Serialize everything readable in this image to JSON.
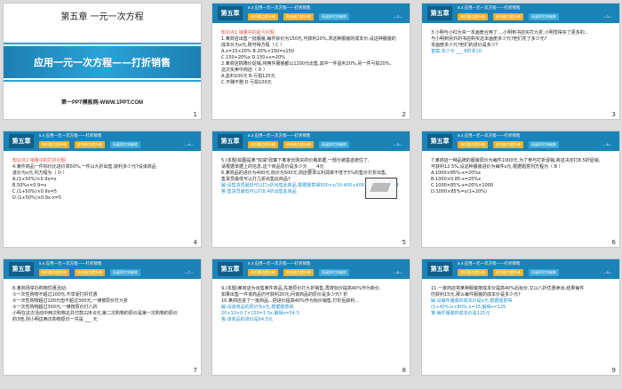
{
  "cover": {
    "chapter": "第五章 一元一次方程",
    "subtitle": "应用一元一次方程——打折销售",
    "website": "第一PPT模板网-WWW.1PPT.COM",
    "page": "1"
  },
  "header": {
    "chapter_label": "第五章",
    "section": "5.4 应用一元一次方程——打折销售",
    "tab1": "知识要点提升练",
    "tab2": "综合能力提升练",
    "tab3": "拓展探究突破练"
  },
  "slides": [
    {
      "page": "2",
      "lines": [
        {
          "t": "知识点1 销量中的盈亏问题",
          "c": "hl"
        },
        {
          "t": "1.某商店出售一批服装,每件标价为150元,可获利20%,求这种服装的成本价.设这种服装的",
          "c": ""
        },
        {
          "t": "成本价为x元,则可得方程（ C ）",
          "c": ""
        },
        {
          "t": "A.x=15×20%   B.20%×150=x150",
          "c": ""
        },
        {
          "t": "C.150+20%x D.150+x=20%",
          "c": ""
        },
        {
          "t": "2.某商店搞降价促销,将两件服装都以1200元出售,其中一件盈利20%,另一件亏损20%,",
          "c": ""
        },
        {
          "t": "这次买卖中商店（ D ）",
          "c": ""
        },
        {
          "t": "A.盈利100元  B.亏损125元",
          "c": ""
        },
        {
          "t": "C.不赚不赔  D.亏损100元",
          "c": ""
        }
      ]
    },
    {
      "page": "3",
      "lines": [
        {
          "t": "3.小明与小红为买一本画册合用了...,小明到书店买打九折,小明觉得买了更多的...",
          "c": ""
        },
        {
          "t": "与小明到另外的书店购买这本画册多少元?他们花了多少元?",
          "c": ""
        },
        {
          "t": "本画册多少元?他们的进价是多少?",
          "c": ""
        },
        {
          "t": "答案:多少元 ___ 8折多10",
          "c": "ans"
        }
      ]
    },
    {
      "page": "4",
      "lines": [
        {
          "t": "知识点2 销量中的打折问题",
          "c": "hl"
        },
        {
          "t": "4.某件商品一件标价比进价高50%,一件以九折出售,获利多少元?设该商品",
          "c": ""
        },
        {
          "t": "进价为x元,列方程为（ D ）",
          "c": ""
        },
        {
          "t": "A.(1+50%)×0.9x=x",
          "c": ""
        },
        {
          "t": "B.50%x×0.9=x",
          "c": ""
        },
        {
          "t": "C.(1+50%)×0.9x=5",
          "c": ""
        },
        {
          "t": "D.(1+50%)×0.9x-x=5",
          "c": ""
        }
      ]
    },
    {
      "page": "5",
      "lines": [
        {
          "t": "5.(本题)如图是某\"双减\"政策下某家长购买的价格单据,一部分被墨迹遮住了,",
          "c": ""
        },
        {
          "t": "请根据单据上的信息,这个商品原价是多少元 ___ 4元",
          "c": ""
        },
        {
          "t": "6.某商品的进价为400元,标价为500元,商店要求以利润率不低于5%的售价打折出售,",
          "c": ""
        },
        {
          "t": "售货员最低可以打几折出售此商品?",
          "c": ""
        },
        {
          "t": "解:设售货员最低可以打x折出售此商品,根据题意得500×x/10-400≥400×5%,解得x≥8.4",
          "c": "ans"
        },
        {
          "t": "答:售货员最低可以打8.4折出售此商品",
          "c": "ans"
        }
      ]
    },
    {
      "page": "6",
      "lines": [
        {
          "t": "7.某商店一种品牌的服装原价为每件1000元,为了参与打折促销,商店决定打8.5折促销,",
          "c": ""
        },
        {
          "t": "可获利12.5%,设这种服装进价为每件x元,根据题意列方程为（ B ）",
          "c": ""
        },
        {
          "t": "A.1000×85%-x=20%x",
          "c": ""
        },
        {
          "t": "B.1000×0.85-x=20%x",
          "c": ""
        },
        {
          "t": "C.1000×85%-x=20%×1000",
          "c": ""
        },
        {
          "t": "D.1000×85%=x(1+20%)",
          "c": ""
        }
      ]
    },
    {
      "page": "7",
      "lines": [
        {
          "t": "8.某商场举办购物优惠活动:",
          "c": ""
        },
        {
          "t": "①一次性购物不超过100元,不享受打折优惠",
          "c": ""
        },
        {
          "t": "②一次性购物超过100元但不超过300元,一律按原价打九折",
          "c": ""
        },
        {
          "t": "③一次性购物超过300元,一律按原价打八折",
          "c": ""
        },
        {
          "t": "小明在这次活动中两次购物总共付款228.6元,第二次购物的原价是第一次购物的原价",
          "c": ""
        },
        {
          "t": "的3倍,则小明这两次购物原价一共是 ___ 元",
          "c": ""
        }
      ]
    },
    {
      "page": "8",
      "lines": [
        {
          "t": "9.(本题)某商店为出售某件商品,先按原价打九折销售,再按标价提高40%作为新价,",
          "c": ""
        },
        {
          "t": "如果出售一件该商品仍可获利20元,问该商品的原价是多少元? 折",
          "c": ""
        },
        {
          "t": "10.某商店进了一批商品...把进价提高40%作为标价销售,打折后获利...",
          "c": ""
        },
        {
          "t": "解:设该商品的原价为x元,根据题意得",
          "c": "ans"
        },
        {
          "t": "20+10×0.7×150=1.5x,解得x=54.5",
          "c": "ans"
        },
        {
          "t": "答:该商品的进价是64.5元",
          "c": "ans"
        }
      ]
    },
    {
      "page": "9",
      "lines": [
        {
          "t": "11.一家商店将某种服装按成本价提高40%后标价,又以八折优惠卖出,结果每件",
          "c": ""
        },
        {
          "t": "仍获利15元,那么每件服装的成本价是多少元?",
          "c": ""
        },
        {
          "t": "解:设每件服装的成本价是x元,根据题意得",
          "c": "ans"
        },
        {
          "t": "(1+40%)x×80%-x=15,解得x=125",
          "c": "ans"
        },
        {
          "t": "答:每件服装的成本价是125元",
          "c": "ans"
        }
      ]
    }
  ]
}
